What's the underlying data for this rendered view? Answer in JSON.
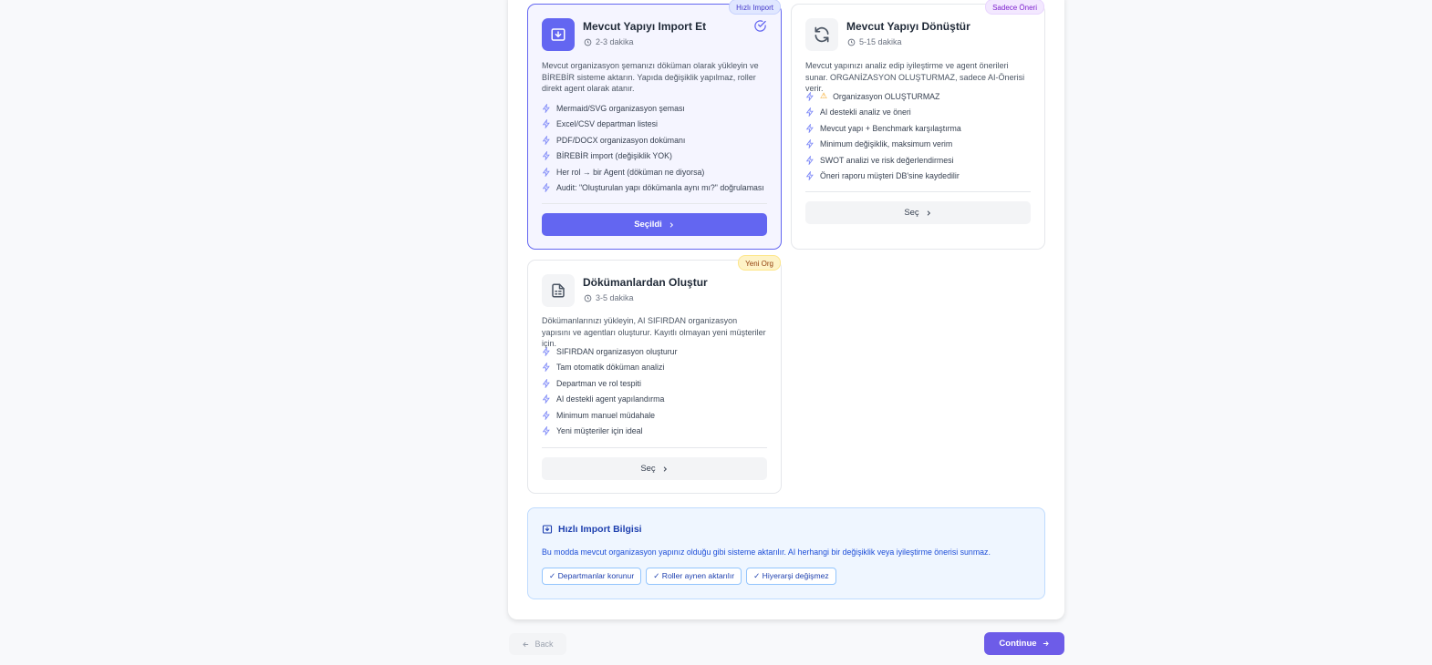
{
  "cards": [
    {
      "badge": "Hızlı Import",
      "title": "Mevcut Yapıyı Import Et",
      "time": "2-3 dakika",
      "description": "Mevcut organizasyon şemanızı döküman olarak yükleyin ve BİREBİR sisteme aktarın. Yapıda değişiklik yapılmaz, roller direkt agent olarak atanır.",
      "features": [
        "Mermaid/SVG organizasyon şeması",
        "Excel/CSV departman listesi",
        "PDF/DOCX organizasyon dokümanı",
        "BİREBİR import (değişiklik YOK)",
        "Her rol → bir Agent (döküman ne diyorsa)",
        "Audit: \"Oluşturulan yapı dökümanla aynı mı?\" doğrulaması"
      ],
      "button": "Seçildi",
      "selected": true
    },
    {
      "badge": "Sadece Öneri",
      "title": "Mevcut Yapıyı Dönüştür",
      "time": "5-15 dakika",
      "description": "Mevcut yapınızı analiz edip iyileştirme ve agent önerileri sunar. ORGANİZASYON OLUŞTURMAZ, sadece AI-Önerisi verir.",
      "warning_feature": "Organizasyon OLUŞTURMAZ",
      "features": [
        "AI destekli analiz ve öneri",
        "Mevcut yapı + Benchmark karşılaştırma",
        "Minimum değişiklik, maksimum verim",
        "SWOT analizi ve risk değerlendirmesi",
        "Öneri raporu müşteri DB'sine kaydedilir"
      ],
      "button": "Seç",
      "selected": false
    },
    {
      "badge": "Yeni Org",
      "title": "Dökümanlardan Oluştur",
      "time": "3-5 dakika",
      "description": "Dökümanlarınızı yükleyin, AI SIFIRDAN organizasyon yapısını ve agentları oluşturur. Kayıtlı olmayan yeni müşteriler için.",
      "features": [
        "SIFIRDAN organizasyon oluşturur",
        "Tam otomatik döküman analizi",
        "Departman ve rol tespiti",
        "AI destekli agent yapılandırma",
        "Minimum manuel müdahale",
        "Yeni müşteriler için ideal"
      ],
      "button": "Seç",
      "selected": false
    }
  ],
  "info": {
    "title": "Hızlı Import Bilgisi",
    "text": "Bu modda mevcut organizasyon yapınız olduğu gibi sisteme aktarılır. AI herhangi bir değişiklik veya iyileştirme önerisi sunmaz.",
    "chips": [
      "✓ Departmanlar korunur",
      "✓ Roller aynen aktarılır",
      "✓ Hiyerarşi değişmez"
    ]
  },
  "nav": {
    "back": "Back",
    "continue": "Continue"
  },
  "colors": {
    "accent": "#6366f1",
    "info_bg": "#eff6ff",
    "info_text": "#1d4ed8"
  }
}
